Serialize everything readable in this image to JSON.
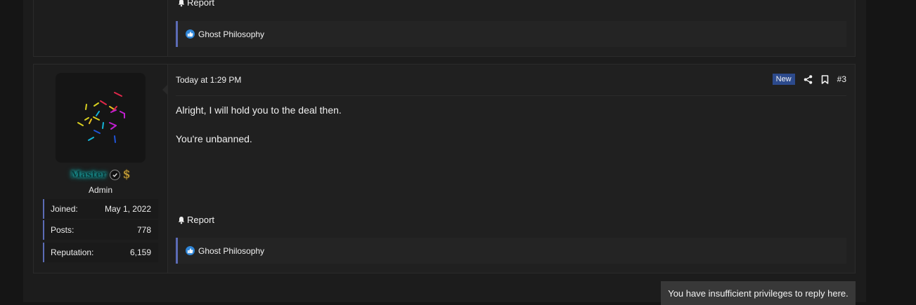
{
  "previous_post": {
    "report_label": "Report",
    "reaction_summary": "Ghost Philosophy"
  },
  "post": {
    "timestamp": "Today at 1:29 PM",
    "badge": "New",
    "post_number": "#3",
    "user": {
      "username": "Master",
      "title": "Admin",
      "stats": [
        {
          "label": "Joined:",
          "value": "May 1, 2022"
        },
        {
          "label": "Posts:",
          "value": "778"
        },
        {
          "label": "Reputation:",
          "value": "6,159"
        }
      ]
    },
    "message": [
      "Alright, I will hold you to the deal then.",
      "You're unbanned."
    ],
    "report_label": "Report",
    "reaction_summary": "Ghost Philosophy"
  },
  "notice": "You have insufficient privileges to reply here.",
  "colors": {
    "accent_border": "#5b6bb5",
    "new_badge": "#2c4a8c",
    "like_icon": "#2f86d8",
    "username_glow": "#19d3d3",
    "dollar_gold": "#c9a23a"
  },
  "icons": [
    "bell-icon",
    "like-icon",
    "share-icon",
    "bookmark-icon",
    "verified-icon",
    "dollar-icon"
  ]
}
